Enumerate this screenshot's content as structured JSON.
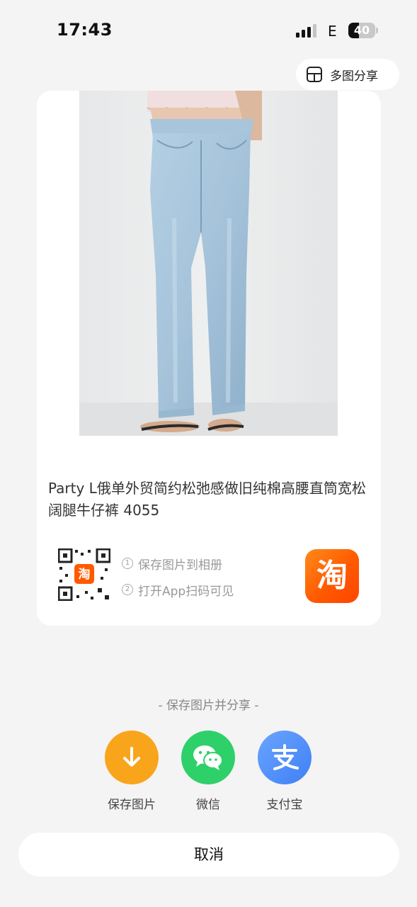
{
  "status_bar": {
    "time": "17:43",
    "network": "E",
    "battery": "40",
    "battery_level": 0.4,
    "signal_bars_active": 3,
    "icons": [
      "signal-icon",
      "battery-icon"
    ]
  },
  "multi_share": {
    "label": "多图分享",
    "icon": "grid-layout-icon"
  },
  "product": {
    "title": "Party L俄单外贸简约松弛感做旧纯棉高腰直筒宽松阔腿牛仔裤 4055",
    "image": "product-photo-wide-leg-jeans",
    "qr_badge": "淘",
    "steps": [
      {
        "num": "1",
        "text": "保存图片到相册"
      },
      {
        "num": "2",
        "text": "打开App扫码可见"
      }
    ],
    "app_logo_text": "淘"
  },
  "share": {
    "caption": "- 保存图片并分享 -",
    "buttons": [
      {
        "label": "保存图片",
        "icon": "download-icon",
        "color": "#f9a51c"
      },
      {
        "label": "微信",
        "icon": "wechat-icon",
        "color": "#2ed06a"
      },
      {
        "label": "支付宝",
        "icon": "alipay-icon",
        "color": "#4f8dfb"
      }
    ]
  },
  "cancel_label": "取消",
  "colors": {
    "background": "#f4f4f4",
    "card": "#ffffff",
    "taobao_orange": "#ff5a00"
  }
}
